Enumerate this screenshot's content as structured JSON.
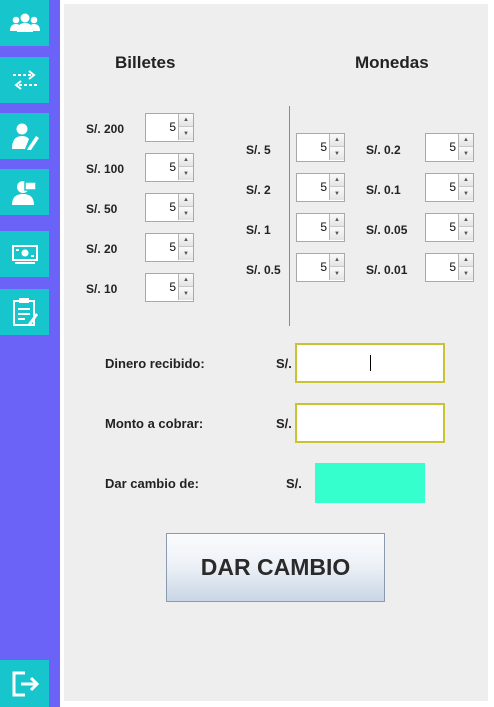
{
  "sidebar": {
    "items": [
      {
        "icon": "users-icon"
      },
      {
        "icon": "transfer-icon"
      },
      {
        "icon": "user-edit-icon"
      },
      {
        "icon": "user-card-icon"
      },
      {
        "icon": "money-icon"
      },
      {
        "icon": "clipboard-icon"
      }
    ],
    "logout_icon": "logout-icon"
  },
  "billetes": {
    "title": "Billetes",
    "items": [
      {
        "label": "S/. 200",
        "value": "5"
      },
      {
        "label": "S/. 100",
        "value": "5"
      },
      {
        "label": "S/. 50",
        "value": "5"
      },
      {
        "label": "S/. 20",
        "value": "5"
      },
      {
        "label": "S/. 10",
        "value": "5"
      }
    ]
  },
  "monedas": {
    "title": "Monedas",
    "left": [
      {
        "label": "S/. 5",
        "value": "5"
      },
      {
        "label": "S/. 2",
        "value": "5"
      },
      {
        "label": "S/. 1",
        "value": "5"
      },
      {
        "label": "S/. 0.5",
        "value": "5"
      }
    ],
    "right": [
      {
        "label": "S/. 0.2",
        "value": "5"
      },
      {
        "label": "S/. 0.1",
        "value": "5"
      },
      {
        "label": "S/. 0.05",
        "value": "5"
      },
      {
        "label": "S/. 0.01",
        "value": "5"
      }
    ]
  },
  "form": {
    "recibido_label": "Dinero recibido:",
    "cobrar_label": "Monto a cobrar:",
    "cambio_label": "Dar cambio de:",
    "currency": "S/.",
    "recibido_value": "",
    "cobrar_value": "",
    "cambio_value": ""
  },
  "button": {
    "label": "DAR CAMBIO"
  },
  "colors": {
    "sidebar": "#6b63f7",
    "accent": "#17c6cc",
    "result": "#35ffcd",
    "input_border": "#c9c233"
  }
}
